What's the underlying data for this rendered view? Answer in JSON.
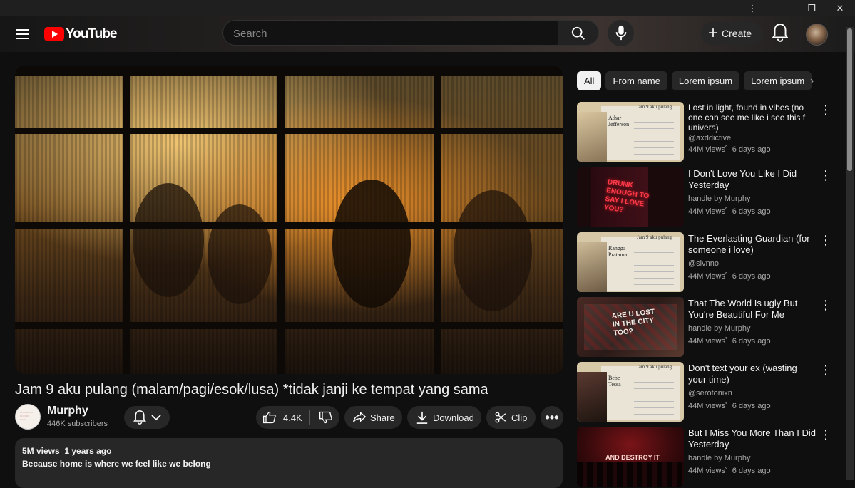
{
  "masthead": {
    "logo_text": "YouTube",
    "search_placeholder": "Search",
    "create_label": "Create"
  },
  "video": {
    "title": "Jam 9 aku pulang (malam/pagi/esok/lusa) *tidak janji ke tempat yang sama",
    "channel_name": "Murphy",
    "subscribers": "446K subscribers",
    "likes": "4.4K",
    "share_label": "Share",
    "download_label": "Download",
    "clip_label": "Clip",
    "views": "5M views",
    "age": "1 years ago",
    "description": "Because home is where we feel like we belong"
  },
  "chips": [
    "All",
    "From name",
    "Lorem ipsum",
    "Lorem ipsum"
  ],
  "recommendations": [
    {
      "title": "Lost in light, found in vibes (no one can see me like i see this f univers)",
      "handle": "@axddictive",
      "views": "44M views",
      "age": "6 days ago"
    },
    {
      "title": "I Don't Love You Like I Did Yesterday",
      "handle": "handle by Murphy",
      "views": "44M views",
      "age": "6 days ago"
    },
    {
      "title": "The Everlasting Guardian (for someone i love)",
      "handle": "@sivnno",
      "views": "44M views",
      "age": "6 days ago"
    },
    {
      "title": "That The World Is ugly But You're Beautiful For Me",
      "handle": "handle by Murphy",
      "views": "44M views",
      "age": "6 days ago"
    },
    {
      "title": "Don't text your ex (wasting your time)",
      "handle": "@serotonixn",
      "views": "44M views",
      "age": "6 days ago"
    },
    {
      "title": "But I Miss You More Than I Did Yesterday",
      "handle": "handle by Murphy",
      "views": "44M views",
      "age": "6 days ago"
    }
  ],
  "thumbnails": {
    "poster_heading": "Jam 9 aku pulang",
    "poster1_name": "Athar Jefferson",
    "poster3_name": "Rangga Pratama",
    "poster5_name": "Bebe Tessa",
    "neon_text": "DRUNK ENOUGH TO SAY I LOVE YOU?",
    "graffiti_text": "ARE U LOST IN THE CITY TOO?",
    "concert_text": "AND DESTROY IT"
  },
  "colors": {
    "background": "#0f0f0f",
    "surface": "#272727",
    "brand_red": "#ff0000",
    "text_secondary": "#aaaaaa"
  }
}
